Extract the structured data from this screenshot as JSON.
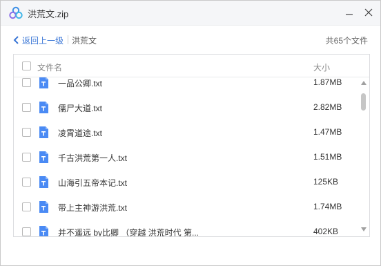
{
  "window": {
    "title": "洪荒文.zip",
    "app_icon": "cloud-logo-icon",
    "minimize_icon": "minimize-icon",
    "close_icon": "close-icon"
  },
  "nav": {
    "back_label": "返回上一级",
    "current_folder": "洪荒文",
    "total_files": "共65个文件"
  },
  "list": {
    "header_name": "文件名",
    "header_size": "大小",
    "file_icon": "txt-file-icon",
    "files": [
      {
        "name": "一品公卿.txt",
        "size": "1.87MB"
      },
      {
        "name": "儒尸大道.txt",
        "size": "2.82MB"
      },
      {
        "name": "凌霄道途.txt",
        "size": "1.47MB"
      },
      {
        "name": "千古洪荒第一人.txt",
        "size": "1.51MB"
      },
      {
        "name": "山海引五帝本记.txt",
        "size": "125KB"
      },
      {
        "name": "带上主神游洪荒.txt",
        "size": "1.74MB"
      },
      {
        "name": "并不遥远 by比卿 （穿越 洪荒时代 第...",
        "size": "402KB"
      }
    ]
  },
  "colors": {
    "accent": "#3a76d6",
    "file_icon": "#4a8af4",
    "logo_blue": "#3a8ee6",
    "logo_purple": "#8b6ee8"
  }
}
